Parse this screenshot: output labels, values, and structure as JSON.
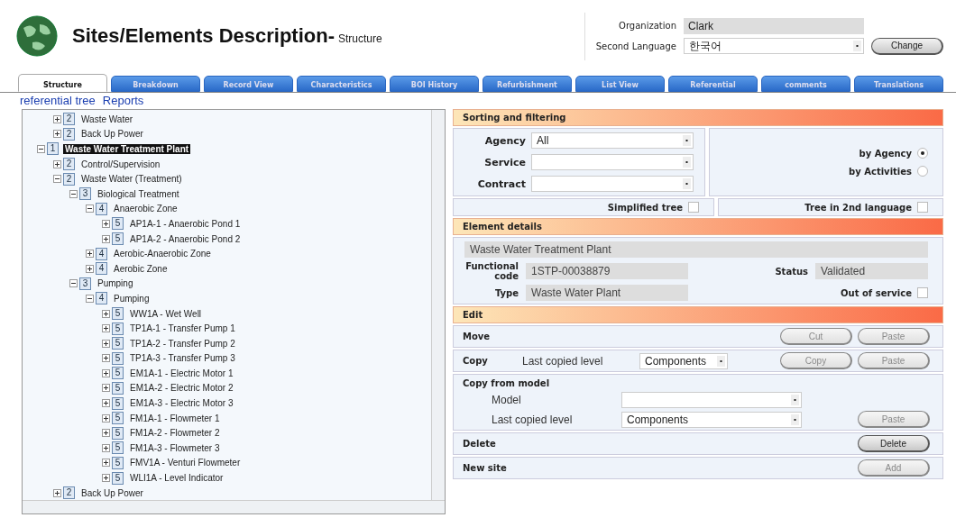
{
  "header": {
    "title": "Sites/Elements Description-",
    "subtitle": "Structure",
    "organization": {
      "label": "Organization",
      "value": "Clark"
    },
    "second_language": {
      "label": "Second Language",
      "value": "한국어"
    },
    "change_button": "Change"
  },
  "tabs": [
    {
      "label": "Structure",
      "selected": true
    },
    {
      "label": "Breakdown",
      "selected": false
    },
    {
      "label": "Record View",
      "selected": false
    },
    {
      "label": "Characteristics",
      "selected": false
    },
    {
      "label": "BOI History",
      "selected": false
    },
    {
      "label": "Refurbishment",
      "selected": false
    },
    {
      "label": "List View",
      "selected": false
    },
    {
      "label": "Referential",
      "selected": false
    },
    {
      "label": "comments",
      "selected": false
    },
    {
      "label": "Translations",
      "selected": false
    }
  ],
  "links": [
    "referential tree",
    "Reports"
  ],
  "tree": {
    "continued": [
      {
        "badge": "2",
        "label": "Waste Water",
        "expanded": false,
        "selected": false
      },
      {
        "badge": "2",
        "label": "Back Up Power",
        "expanded": false,
        "selected": false
      }
    ],
    "nodes": [
      {
        "badge": "1",
        "label": "Waste Water Treatment Plant",
        "expanded": true,
        "selected": true,
        "children": [
          {
            "badge": "2",
            "label": "Control/Supervision",
            "expanded": false,
            "selected": false
          },
          {
            "badge": "2",
            "label": "Waste Water (Treatment)",
            "expanded": true,
            "selected": false,
            "children": [
              {
                "badge": "3",
                "label": "Biological Treatment",
                "expanded": true,
                "selected": false,
                "children": [
                  {
                    "badge": "4",
                    "label": "Anaerobic Zone",
                    "expanded": true,
                    "selected": false,
                    "children": [
                      {
                        "badge": "5",
                        "label": "AP1A-1 - Anaerobic Pond 1",
                        "expanded": false,
                        "selected": false
                      },
                      {
                        "badge": "5",
                        "label": "AP1A-2 - Anaerobic Pond 2",
                        "expanded": false,
                        "selected": false
                      }
                    ]
                  },
                  {
                    "badge": "4",
                    "label": "Aerobic-Anaerobic Zone",
                    "expanded": false,
                    "selected": false
                  },
                  {
                    "badge": "4",
                    "label": "Aerobic Zone",
                    "expanded": false,
                    "selected": false
                  }
                ]
              },
              {
                "badge": "3",
                "label": "Pumping",
                "expanded": true,
                "selected": false,
                "children": [
                  {
                    "badge": "4",
                    "label": "Pumping",
                    "expanded": true,
                    "selected": false,
                    "children": [
                      {
                        "badge": "5",
                        "label": "WW1A - Wet Well",
                        "expanded": false,
                        "selected": false
                      },
                      {
                        "badge": "5",
                        "label": "TP1A-1 - Transfer Pump 1",
                        "expanded": false,
                        "selected": false
                      },
                      {
                        "badge": "5",
                        "label": "TP1A-2 - Transfer Pump 2",
                        "expanded": false,
                        "selected": false
                      },
                      {
                        "badge": "5",
                        "label": "TP1A-3 - Transfer Pump 3",
                        "expanded": false,
                        "selected": false
                      },
                      {
                        "badge": "5",
                        "label": "EM1A-1 - Electric Motor 1",
                        "expanded": false,
                        "selected": false
                      },
                      {
                        "badge": "5",
                        "label": "EM1A-2 - Electric Motor 2",
                        "expanded": false,
                        "selected": false
                      },
                      {
                        "badge": "5",
                        "label": "EM1A-3 - Electric Motor 3",
                        "expanded": false,
                        "selected": false
                      },
                      {
                        "badge": "5",
                        "label": "FM1A-1 - Flowmeter 1",
                        "expanded": false,
                        "selected": false
                      },
                      {
                        "badge": "5",
                        "label": "FM1A-2 - Flowmeter 2",
                        "expanded": false,
                        "selected": false
                      },
                      {
                        "badge": "5",
                        "label": "FM1A-3 - Flowmeter 3",
                        "expanded": false,
                        "selected": false
                      },
                      {
                        "badge": "5",
                        "label": "FMV1A - Venturi Flowmeter",
                        "expanded": false,
                        "selected": false
                      },
                      {
                        "badge": "5",
                        "label": "WLI1A - Level Indicator",
                        "expanded": false,
                        "selected": false
                      }
                    ]
                  }
                ]
              }
            ]
          },
          {
            "badge": "2",
            "label": "Back Up Power",
            "expanded": false,
            "selected": false
          }
        ]
      }
    ]
  },
  "sorting": {
    "title": "Sorting and filtering",
    "filters": [
      {
        "label": "Agency",
        "value": "All"
      },
      {
        "label": "Service"
      },
      {
        "label": "Contract"
      }
    ],
    "radios": [
      {
        "label": "by Agency",
        "selected": true
      },
      {
        "label": "by Activities",
        "selected": false
      }
    ],
    "checkboxes": [
      {
        "label": "Simplified tree",
        "checked": false
      },
      {
        "label": "Tree in 2nd language",
        "checked": false
      }
    ]
  },
  "element_details": {
    "title": "Element details",
    "name": "Waste Water Treatment Plant",
    "functional_code": {
      "label": "Functional code",
      "value": "1STP-00038879"
    },
    "type": {
      "label": "Type",
      "value": "Waste Water Plant"
    },
    "status": {
      "label": "Status",
      "value": "Validated"
    },
    "out_of_service": {
      "label": "Out of service",
      "checked": false
    }
  },
  "edit": {
    "title": "Edit",
    "rows": [
      {
        "kind": "move",
        "label": "Move",
        "buttons": [
          {
            "label": "Cut",
            "disabled": true
          },
          {
            "label": "Paste",
            "disabled": true
          }
        ]
      },
      {
        "kind": "copy",
        "label": "Copy",
        "level_label": "Last copied level",
        "level_value": "Components",
        "buttons": [
          {
            "label": "Copy",
            "disabled": true
          },
          {
            "label": "Paste",
            "disabled": true
          }
        ]
      },
      {
        "kind": "model",
        "label": "Copy from model",
        "model_label": "Model",
        "level_label": "Last copied level",
        "level_value": "Components",
        "buttons": [
          {
            "label": "Paste",
            "disabled": true
          }
        ]
      },
      {
        "kind": "plain",
        "label": "Delete",
        "buttons": [
          {
            "label": "Delete",
            "disabled": false
          }
        ]
      },
      {
        "kind": "plain",
        "label": "New site",
        "buttons": [
          {
            "label": "Add",
            "disabled": true
          }
        ]
      }
    ]
  }
}
